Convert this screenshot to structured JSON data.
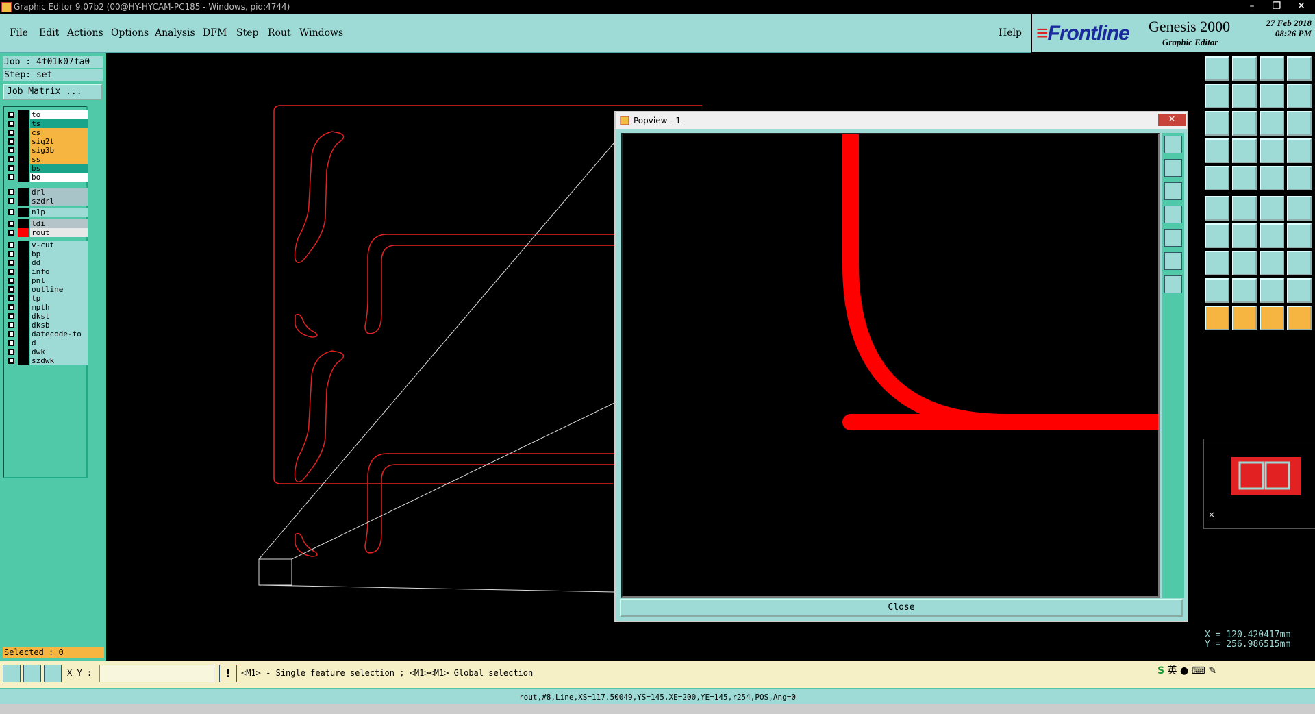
{
  "window": {
    "title": "Graphic Editor 9.07b2 (00@HY-HYCAM-PC185 - Windows, pid:4744)",
    "min_label": "–",
    "max_label": "❐",
    "close_label": "✕"
  },
  "menu": {
    "items": [
      "File",
      "Edit",
      "Actions",
      "Options",
      "Analysis",
      "DFM",
      "Step",
      "Rout",
      "Windows"
    ],
    "help": "Help"
  },
  "brand": {
    "logo": "Frontline",
    "product": "Genesis 2000",
    "subtitle": "Graphic Editor",
    "date": "27 Feb 2018",
    "time": "08:26 PM"
  },
  "job": {
    "job_line": "Job : 4f01k07fa0",
    "step_line": "Step: set",
    "matrix_button": "Job Matrix ..."
  },
  "layers": [
    {
      "name": "to",
      "color": "#ffffff"
    },
    {
      "name": "ts",
      "color": "#1aa48a"
    },
    {
      "name": "cs",
      "color": "#f5b540"
    },
    {
      "name": "sig2t",
      "color": "#f5b540"
    },
    {
      "name": "sig3b",
      "color": "#f5b540"
    },
    {
      "name": "ss",
      "color": "#f5b540"
    },
    {
      "name": "bs",
      "color": "#1aa48a"
    },
    {
      "name": "bo",
      "color": "#ffffff"
    },
    {
      "name": "drl",
      "color": "#a8c4c8"
    },
    {
      "name": "szdrl",
      "color": "#a8c4c8"
    },
    {
      "name": "n1p",
      "color": "#9edad6"
    },
    {
      "name": "ldi",
      "color": "#b4c4c8"
    },
    {
      "name": "rout",
      "color": "#e8e8e8"
    },
    {
      "name": "v-cut",
      "color": "#9edad6"
    },
    {
      "name": "bp",
      "color": "#9edad6"
    },
    {
      "name": "dd",
      "color": "#9edad6"
    },
    {
      "name": "info",
      "color": "#9edad6"
    },
    {
      "name": "pnl",
      "color": "#9edad6"
    },
    {
      "name": "outline",
      "color": "#9edad6"
    },
    {
      "name": "tp",
      "color": "#9edad6"
    },
    {
      "name": "mpth",
      "color": "#9edad6"
    },
    {
      "name": "dkst",
      "color": "#9edad6"
    },
    {
      "name": "dksb",
      "color": "#9edad6"
    },
    {
      "name": "datecode-to",
      "color": "#9edad6"
    },
    {
      "name": "d",
      "color": "#9edad6"
    },
    {
      "name": "dwk",
      "color": "#9edad6"
    },
    {
      "name": "szdwk",
      "color": "#9edad6"
    }
  ],
  "selected": "Selected : 0",
  "popview": {
    "title": "Popview - 1",
    "close_button": "Close"
  },
  "coords": {
    "x": "X = 120.420417mm",
    "y": "Y = 256.986515mm"
  },
  "bottom": {
    "xy_label": "X Y :",
    "xy_value": "",
    "hint": "<M1> - Single feature selection ; <M1><M1> Global selection",
    "status": "rout,#8,Line,XS=117.50049,YS=145,XE=200,YE=145,r254,POS,Ang=0",
    "ime_label": "英"
  },
  "colors": {
    "panel": "#9edad6",
    "dark_teal": "#4fc9a8",
    "board_outline": "#e22222",
    "rout_feature": "#ff0000",
    "highlight": "#f5b540"
  }
}
